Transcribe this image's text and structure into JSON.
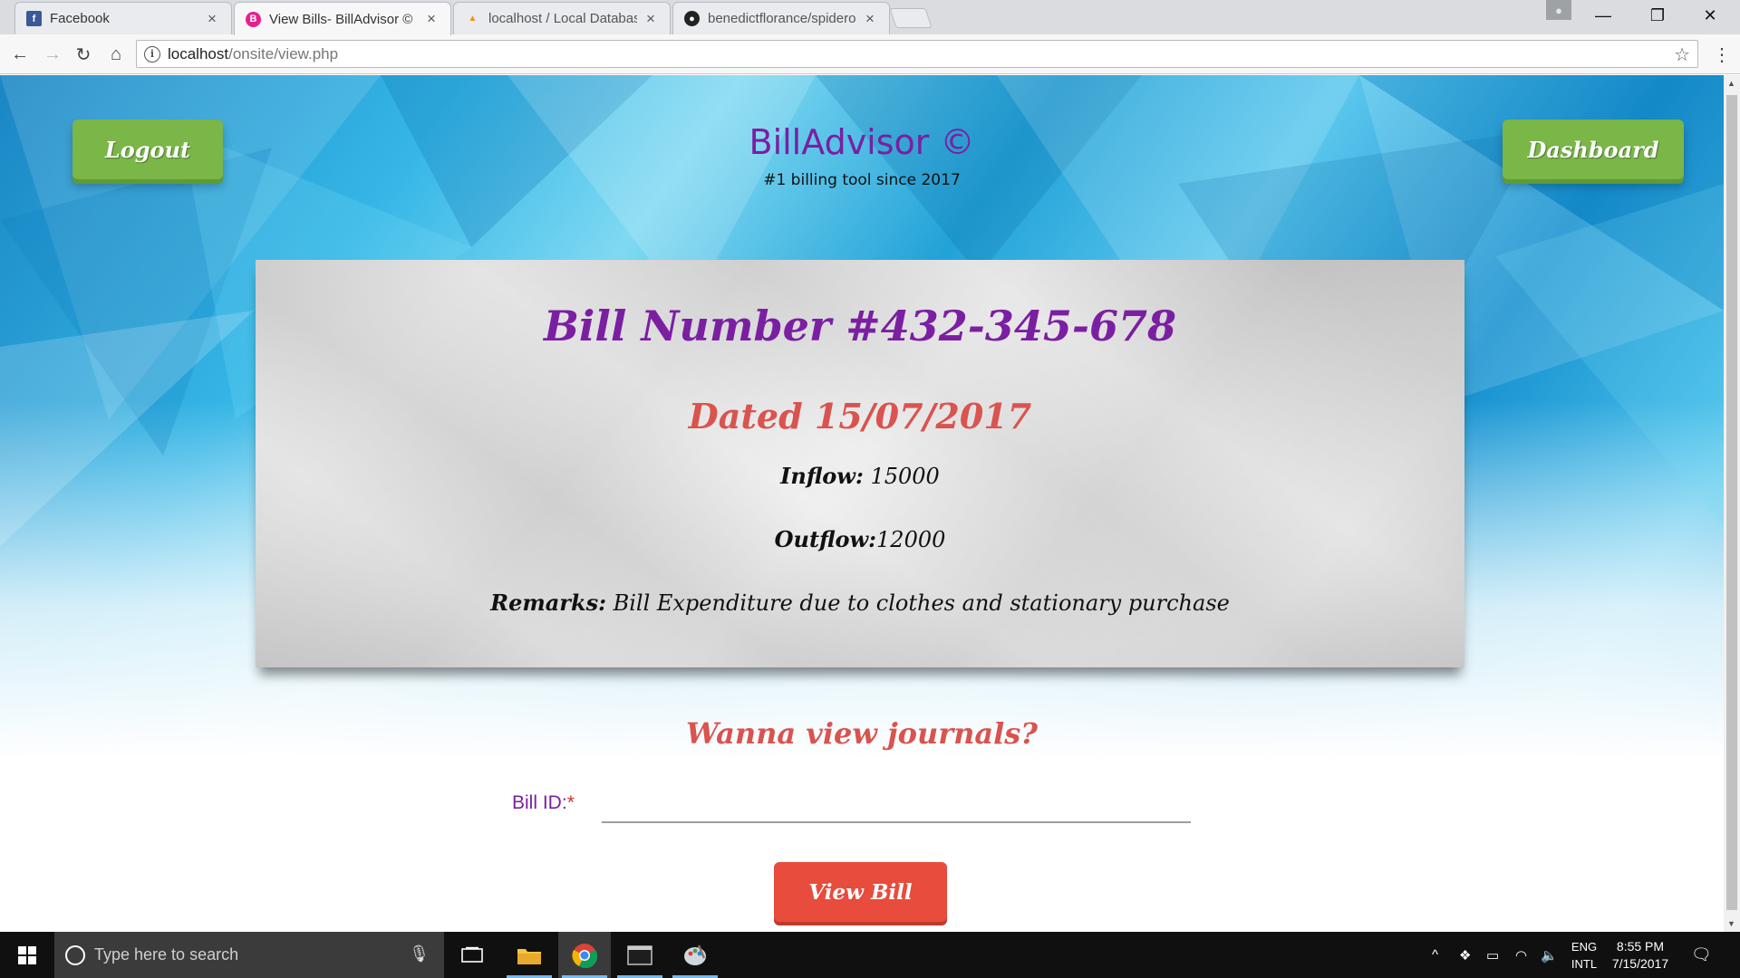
{
  "browser": {
    "tabs": [
      {
        "title": "Facebook",
        "favicon": "facebook-icon"
      },
      {
        "title": "View Bills- BillAdvisor ©",
        "favicon": "billadvisor-icon"
      },
      {
        "title": "localhost / Local Databas",
        "favicon": "phpmyadmin-icon"
      },
      {
        "title": "benedictflorance/spidero",
        "favicon": "github-icon"
      }
    ],
    "url_host": "localhost",
    "url_path": "/onsite/view.php"
  },
  "page": {
    "logout_label": "Logout",
    "dashboard_label": "Dashboard",
    "brand": "BillAdvisor ©",
    "tagline": "#1 billing tool since 2017",
    "bill": {
      "number_text": "Bill Number #432-345-678",
      "date_text": "Dated 15/07/2017",
      "inflow_label": "Inflow:",
      "inflow_value": " 15000",
      "outflow_label": "Outflow:",
      "outflow_value": "12000",
      "remarks_label": "Remarks:",
      "remarks_value": " Bill Expenditure due to clothes and stationary purchase"
    },
    "form": {
      "title": "Wanna view journals?",
      "bill_id_label": "Bill ID:",
      "required_mark": "*",
      "bill_id_value": "",
      "submit_label": "View Bill"
    }
  },
  "taskbar": {
    "search_placeholder": "Type here to search",
    "lang_line1": "ENG",
    "lang_line2": "INTL",
    "time": "8:55 PM",
    "date": "7/15/2017"
  },
  "colors": {
    "brand_purple": "#7b1fa2",
    "accent_red": "#d9534f",
    "button_green": "#7ab648",
    "button_red": "#e74c3c"
  }
}
